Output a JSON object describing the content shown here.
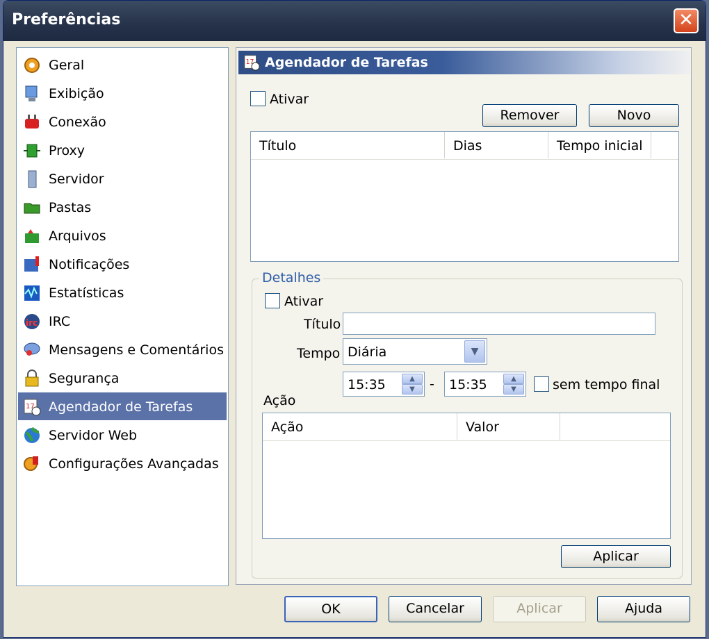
{
  "window": {
    "title": "Preferências"
  },
  "sidebar": {
    "items": [
      {
        "label": "Geral",
        "icon": "gear-icon"
      },
      {
        "label": "Exibição",
        "icon": "monitor-icon"
      },
      {
        "label": "Conexão",
        "icon": "plug-icon"
      },
      {
        "label": "Proxy",
        "icon": "proxy-icon"
      },
      {
        "label": "Servidor",
        "icon": "server-icon"
      },
      {
        "label": "Pastas",
        "icon": "folder-icon"
      },
      {
        "label": "Arquivos",
        "icon": "files-icon"
      },
      {
        "label": "Notificações",
        "icon": "notification-icon"
      },
      {
        "label": "Estatísticas",
        "icon": "statistics-icon"
      },
      {
        "label": "IRC",
        "icon": "irc-icon"
      },
      {
        "label": "Mensagens e Comentários",
        "icon": "messages-icon"
      },
      {
        "label": "Segurança",
        "icon": "lock-icon"
      },
      {
        "label": "Agendador de Tarefas",
        "icon": "calendar-clock-icon"
      },
      {
        "label": "Servidor Web",
        "icon": "globe-icon"
      },
      {
        "label": "Configurações Avançadas",
        "icon": "advanced-settings-icon"
      }
    ],
    "selected_index": 12
  },
  "panel": {
    "title": "Agendador de Tarefas",
    "enable_label": "Ativar",
    "remove_label": "Remover",
    "new_label": "Novo",
    "tasks_columns": [
      "Título",
      "Dias",
      "Tempo inicial"
    ],
    "details": {
      "legend": "Detalhes",
      "enable_label": "Ativar",
      "title_label": "Título",
      "title_value": "",
      "time_label": "Tempo",
      "time_option": "Diária",
      "start_time": "15:35",
      "separator": "-",
      "end_time": "15:35",
      "no_end_label": "sem tempo final",
      "action_label": "Ação",
      "action_columns": [
        "Ação",
        "Valor"
      ],
      "apply_label": "Aplicar"
    }
  },
  "footer": {
    "ok": "OK",
    "cancel": "Cancelar",
    "apply": "Aplicar",
    "help": "Ajuda"
  },
  "colors": {
    "selection": "#5b72a8",
    "header_gradient_start": "#2f4d86",
    "close_button": "#d4441c"
  }
}
